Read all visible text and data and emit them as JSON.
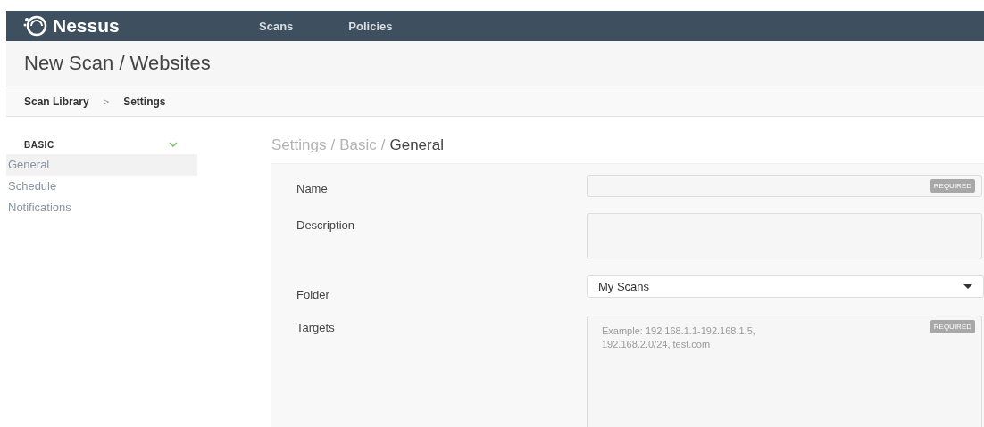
{
  "navbar": {
    "brand": "Nessus",
    "items": [
      {
        "label": "Scans",
        "selected": false
      },
      {
        "label": "Policies",
        "selected": false
      }
    ]
  },
  "page_title": "New Scan / Websites",
  "breadcrumb": {
    "separator": ">",
    "items": [
      {
        "label": "Scan Library"
      },
      {
        "label": "Settings"
      }
    ]
  },
  "sidebar": {
    "section": "BASIC",
    "expanded": true,
    "items": [
      {
        "label": "General",
        "selected": true
      },
      {
        "label": "Schedule",
        "selected": false
      },
      {
        "label": "Notifications",
        "selected": false
      }
    ]
  },
  "content_path": {
    "separator": "/",
    "items": [
      {
        "label": "Settings",
        "selected": false
      },
      {
        "label": "Basic",
        "selected": false
      },
      {
        "label": "General",
        "selected": true
      }
    ]
  },
  "fields": [
    {
      "label": "Name",
      "kind": "text",
      "required_badge": "REQUIRED"
    },
    {
      "label": "Description",
      "kind": "textarea"
    },
    {
      "label": "Folder",
      "kind": "select",
      "value": "My Scans"
    },
    {
      "label": "Targets",
      "kind": "bigtextarea",
      "required_badge": "REQUIRED",
      "placeholder": "Example: 192.168.1.1-192.168.1.5, 192.168.2.0/24, test.com"
    }
  ]
}
